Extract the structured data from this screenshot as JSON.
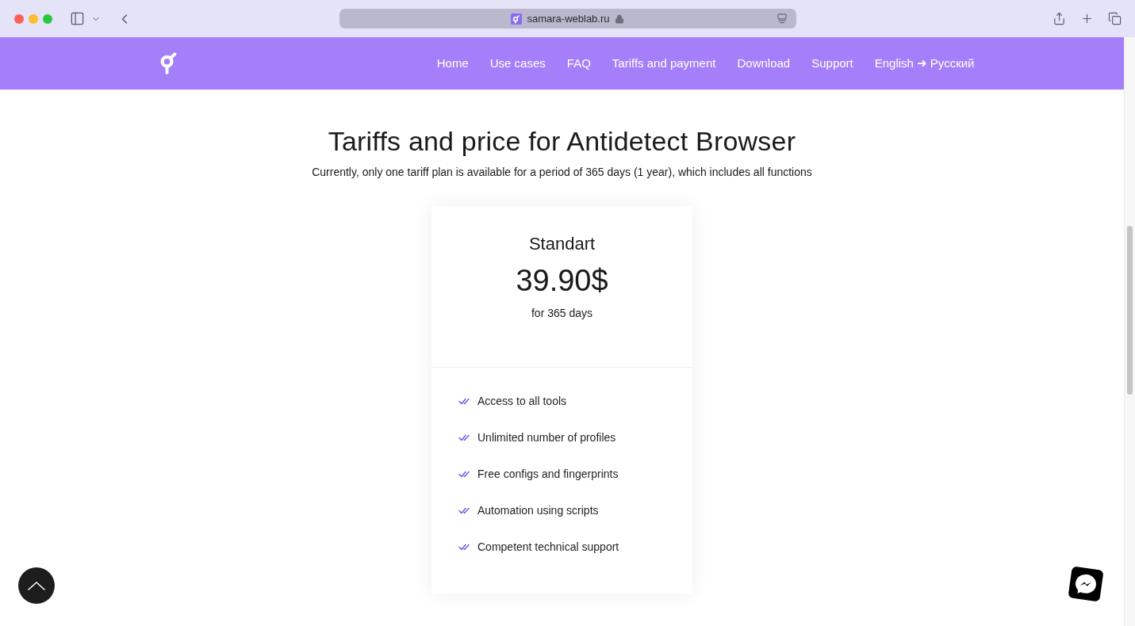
{
  "browser": {
    "url": "samara-weblab.ru"
  },
  "nav": {
    "items": [
      {
        "label": "Home"
      },
      {
        "label": "Use cases"
      },
      {
        "label": "FAQ"
      },
      {
        "label": "Tariffs and payment"
      },
      {
        "label": "Download"
      },
      {
        "label": "Support"
      },
      {
        "label": "English ➜ Русский"
      }
    ]
  },
  "hero": {
    "title": "Tariffs and price for Antidetect Browser",
    "subtitle": "Currently, only one tariff plan is available for a period of 365 days (1 year), which includes all functions"
  },
  "plan": {
    "name": "Standart",
    "price": "39.90$",
    "period": "for 365 days",
    "features": [
      "Access to all tools",
      "Unlimited number of profiles",
      "Free configs and fingerprints",
      "Automation using scripts",
      "Competent technical support"
    ]
  }
}
